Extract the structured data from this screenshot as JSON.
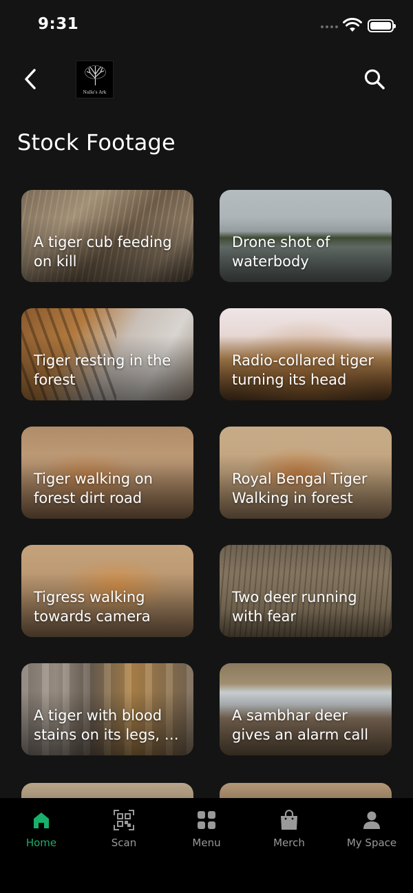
{
  "status_bar": {
    "time": "9:31"
  },
  "header": {
    "logo_text": "Nalla's Ark"
  },
  "page_title": "Stock Footage",
  "cards": [
    {
      "title": "A tiger cub feeding on kill",
      "theme": "dry-grass"
    },
    {
      "title": "Drone shot of waterbody",
      "theme": "water"
    },
    {
      "title": "Tiger resting in the forest",
      "theme": "tiger-rest"
    },
    {
      "title": "Radio-collared tiger turning its head",
      "theme": "tiger-light"
    },
    {
      "title": "Tiger walking on forest dirt road",
      "theme": "dirt-road"
    },
    {
      "title": "Royal Bengal Tiger Walking in forest",
      "theme": "dirt-road-2"
    },
    {
      "title": "Tigress walking towards camera",
      "theme": "tigress"
    },
    {
      "title": "Two deer running with fear",
      "theme": "deer-grass"
    },
    {
      "title": "A tiger with blood stains on its legs, …",
      "theme": "tree-trunk"
    },
    {
      "title": "A sambhar deer gives an alarm call",
      "theme": "sambhar"
    }
  ],
  "nav": [
    {
      "label": "Home",
      "icon": "home-icon",
      "active": true
    },
    {
      "label": "Scan",
      "icon": "qr-scan-icon",
      "active": false
    },
    {
      "label": "Menu",
      "icon": "grid-menu-icon",
      "active": false
    },
    {
      "label": "Merch",
      "icon": "shopping-bag-icon",
      "active": false
    },
    {
      "label": "My Space",
      "icon": "person-icon",
      "active": false
    }
  ],
  "colors": {
    "accent": "#18b06a",
    "background": "#141414",
    "nav_background": "#000000",
    "inactive": "#9a9a9a"
  }
}
